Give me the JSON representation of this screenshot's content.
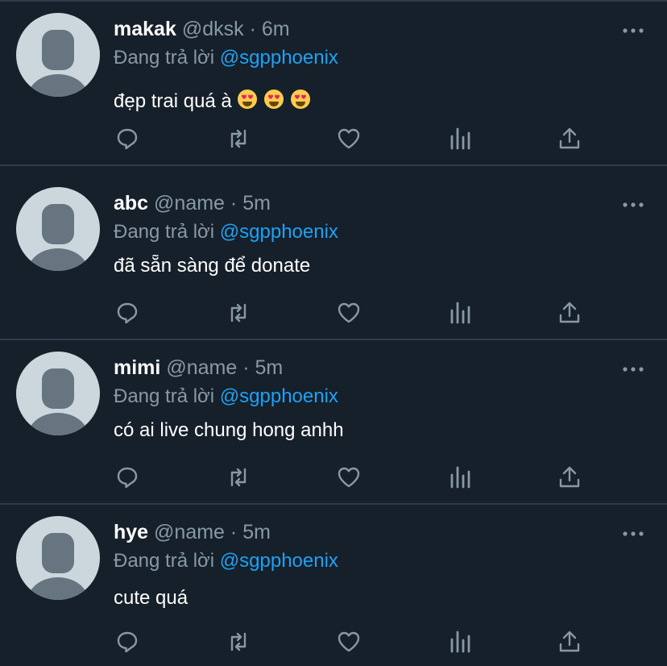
{
  "colors": {
    "background": "#15202b",
    "separator": "#2f3b47",
    "muted": "#8899a6",
    "accent": "#1da1f2",
    "text": "#ffffff"
  },
  "reply_prefix": "Đang trả lời",
  "tweets": [
    {
      "name": "makak",
      "handle": "@dksk",
      "separator": "·",
      "time": "6m",
      "reply_to": "@sgpphoenix",
      "text": "đẹp trai quá à",
      "emojis": [
        "heart-eyes-emoji",
        "heart-eyes-emoji",
        "heart-eyes-emoji"
      ]
    },
    {
      "name": "abc",
      "handle": "@name",
      "separator": "·",
      "time": "5m",
      "reply_to": "@sgpphoenix",
      "text": "đã sẵn sàng để donate"
    },
    {
      "name": "mimi",
      "handle": "@name",
      "separator": "·",
      "time": "5m",
      "reply_to": "@sgpphoenix",
      "text": "có ai live chung hong anhh"
    },
    {
      "name": "hye",
      "handle": "@name",
      "separator": "·",
      "time": "5m",
      "reply_to": "@sgpphoenix",
      "text": "cute quá"
    }
  ],
  "action_icons": [
    "reply-icon",
    "retweet-icon",
    "like-icon",
    "analytics-icon",
    "share-icon"
  ]
}
